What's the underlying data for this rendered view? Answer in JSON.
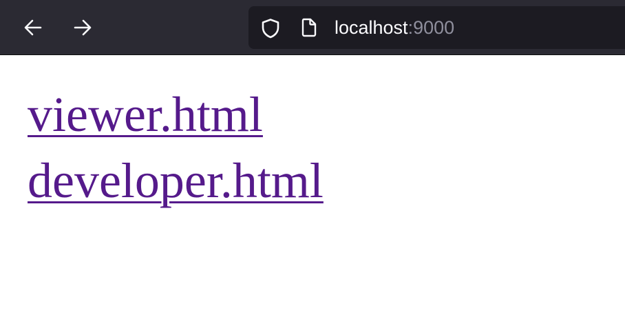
{
  "toolbar": {
    "back_icon": "arrow-left-icon",
    "forward_icon": "arrow-right-icon",
    "shield_icon": "shield-icon",
    "page_icon": "page-icon",
    "url_host": "localhost",
    "url_port": ":9000",
    "colors": {
      "toolbar_bg": "#2b2a33",
      "urlbar_bg": "#1c1b22",
      "icon": "#fbfbfe",
      "port_text": "#8f8f9d"
    }
  },
  "main": {
    "links": [
      {
        "label": "viewer.html"
      },
      {
        "label": "developer.html"
      }
    ],
    "link_color": "#551a8b"
  }
}
